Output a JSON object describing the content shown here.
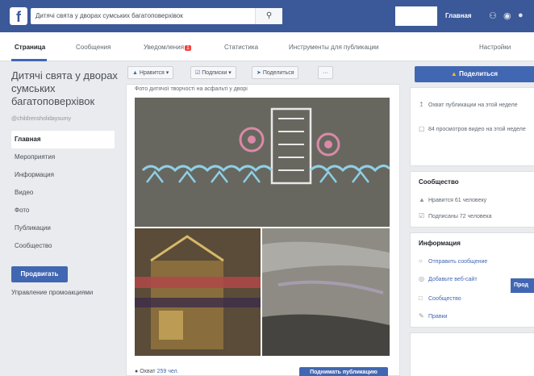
{
  "topbar": {
    "logo": "f",
    "search_value": "Дитячі свята у дворах сумських багатоповерхівок",
    "search_icon": "search-icon",
    "home_label": "Главная"
  },
  "tabs": [
    {
      "label": "Страница"
    },
    {
      "label": "Сообщения"
    },
    {
      "label": "Уведомления",
      "badge": "1"
    },
    {
      "label": "Статистика"
    },
    {
      "label": "Инструменты для публикации"
    },
    {
      "label": "Настройки"
    }
  ],
  "page": {
    "name": "Дитячі свята у дворах сумських багатоповерхівок",
    "handle": "@childrensholidaysumy"
  },
  "nav": [
    {
      "label": "Главная"
    },
    {
      "label": "Мероприятия"
    },
    {
      "label": "Информация"
    },
    {
      "label": "Видео"
    },
    {
      "label": "Фото"
    },
    {
      "label": "Публикации"
    },
    {
      "label": "Сообщество"
    }
  ],
  "promote_label": "Продвигать",
  "promo_manage": "Управление промоакциями",
  "actions": {
    "like": "Нравится ▾",
    "follow": "Подписки ▾",
    "share": "Поделиться",
    "more": "···"
  },
  "post": {
    "top_text": "Фото дитячої творчості на асфальті у дворі",
    "reach_label": "Охват",
    "reach_value": "259 чел.",
    "boost_label": "Поднимать публикацию"
  },
  "right": {
    "share_label": "Поделиться",
    "row1": "Охват публикации на этой неделе",
    "row2": "84 просмотров видео на этой неделе",
    "community_title": "Сообщество",
    "likes": "Нравится 61 человеку",
    "followers": "Подписаны 72 человека",
    "info_title": "Информация",
    "send_message": "Отправить сообщение",
    "add_site": "Добавьте веб-сайт",
    "community_link": "Сообщество",
    "rules_link": "Правки",
    "send_btn": "Прод"
  },
  "colors": {
    "brand": "#3b5998",
    "accent": "#4267b2",
    "badge": "#fa3e3e"
  }
}
